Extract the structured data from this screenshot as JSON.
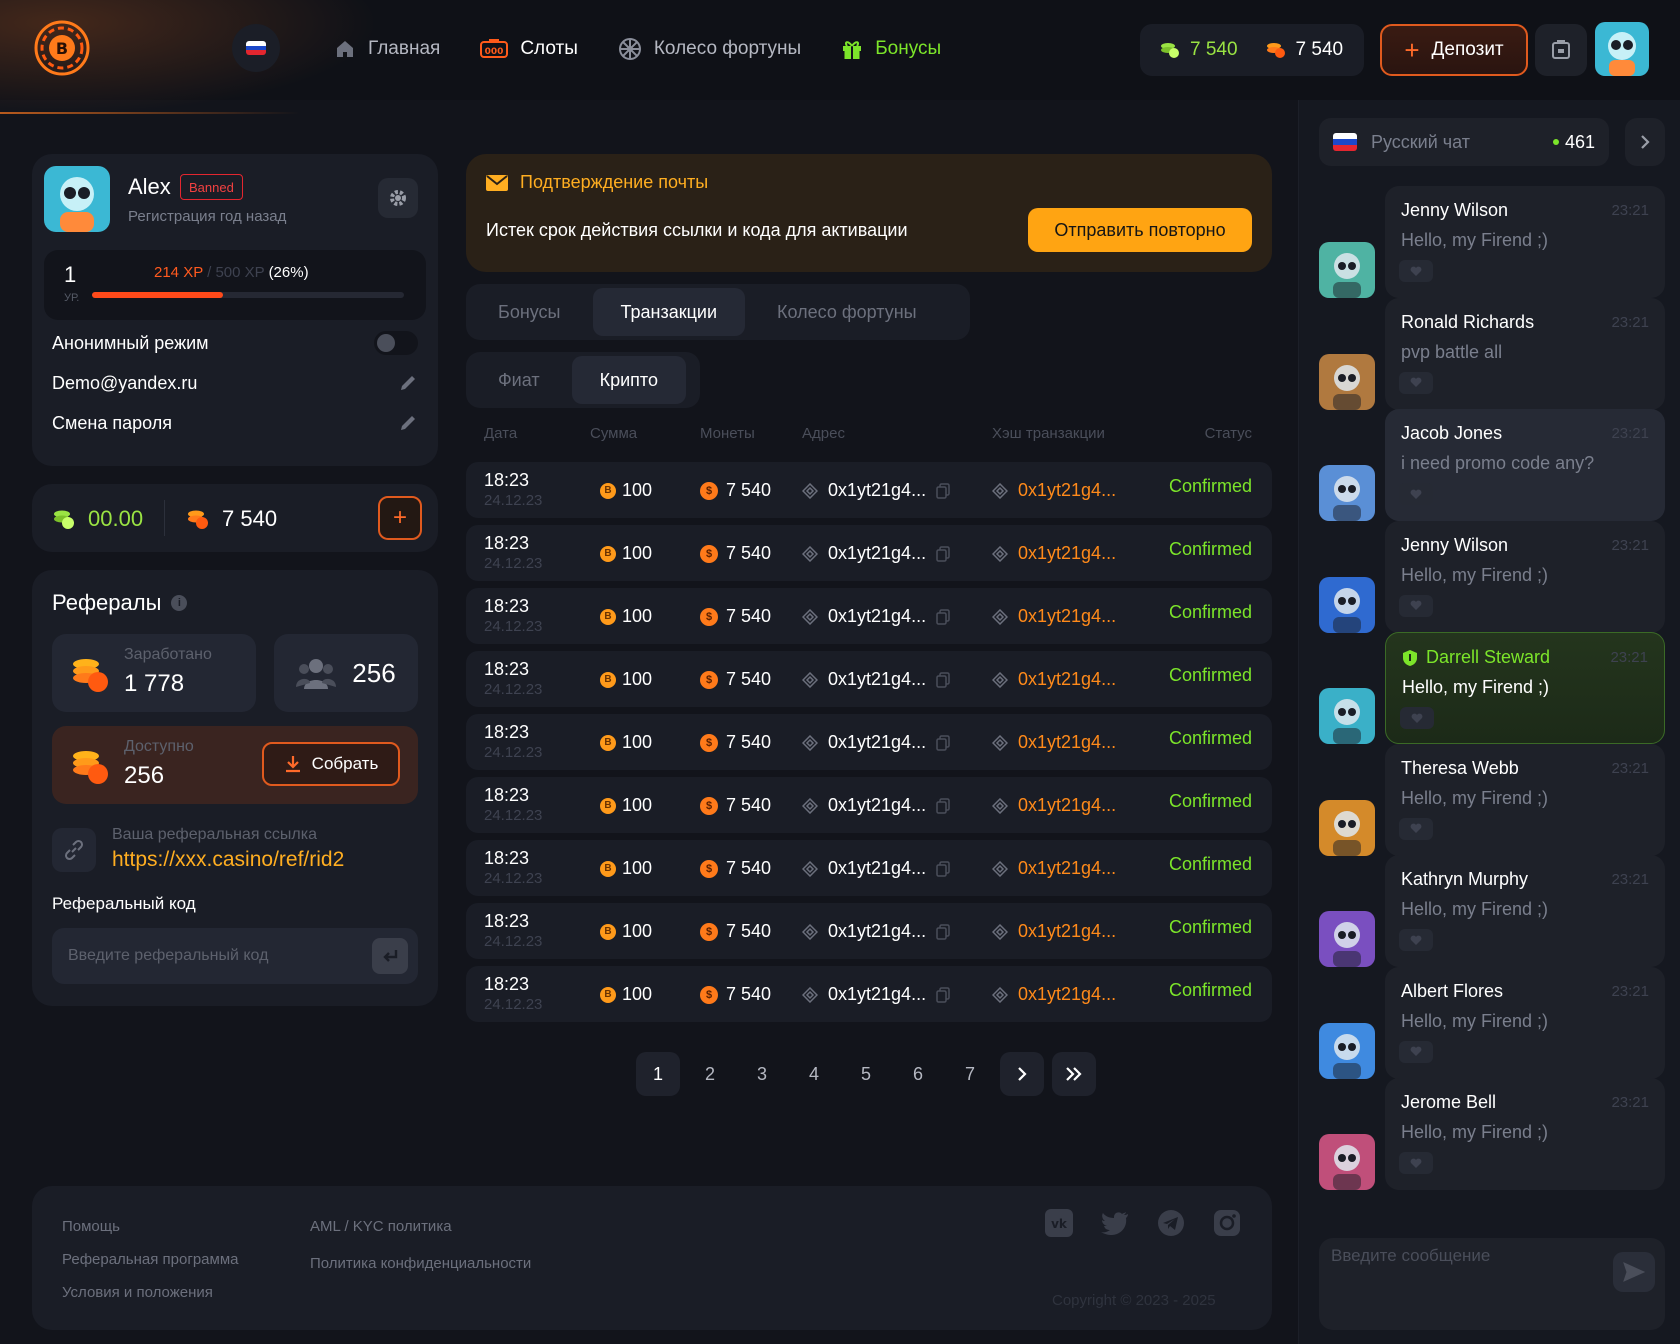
{
  "header": {
    "nav": [
      {
        "label": "Главная",
        "icon": "home-icon"
      },
      {
        "label": "Слоты",
        "icon": "slots-icon"
      },
      {
        "label": "Колесо фортуны",
        "icon": "wheel-icon"
      },
      {
        "label": "Бонусы",
        "icon": "gift-icon"
      }
    ],
    "balance_green": "7 540",
    "balance_orange": "7 540",
    "deposit_label": "Депозит"
  },
  "profile": {
    "name": "Alex",
    "badge": "Banned",
    "registered": "Регистрация год назад",
    "level": "1",
    "level_label": "УР.",
    "xp_current": "214 XP",
    "xp_sep": " / ",
    "xp_max": "500 XP",
    "xp_pct": "(26%)",
    "xp_fraction": 0.42,
    "anon_label": "Анонимный режим",
    "email": "Demo@yandex.ru",
    "password_label": "Смена пароля"
  },
  "wallet": {
    "green": "00.00",
    "orange": "7 540"
  },
  "referrals": {
    "title": "Рефералы",
    "earned_label": "Заработано",
    "earned_value": "1 778",
    "users_count": "256",
    "available_label": "Доступно",
    "available_value": "256",
    "collect_label": "Собрать",
    "link_label": "Ваша реферальная ссылка",
    "link": "https://xxx.casino/ref/rid2",
    "code_label": "Реферальный код",
    "code_placeholder": "Введите реферальный код"
  },
  "alert": {
    "title": "Подтверждение почты",
    "text": "Истек срок действия ссылки и кода для активации",
    "button": "Отправить повторно"
  },
  "tabs": [
    "Бонусы",
    "Транзакции",
    "Колесо фортуны"
  ],
  "subtabs": [
    "Фиат",
    "Крипто"
  ],
  "table": {
    "headers": [
      "Дата",
      "Сумма",
      "Монеты",
      "Адрес",
      "Хэш транзакции",
      "Статус"
    ],
    "rows": [
      {
        "time": "18:23",
        "date": "24.12.23",
        "amount": "100",
        "coins": "7 540",
        "address": "0x1yt21g4...",
        "hash": "0x1yt21g4...",
        "status": "Confirmed"
      },
      {
        "time": "18:23",
        "date": "24.12.23",
        "amount": "100",
        "coins": "7 540",
        "address": "0x1yt21g4...",
        "hash": "0x1yt21g4...",
        "status": "Confirmed"
      },
      {
        "time": "18:23",
        "date": "24.12.23",
        "amount": "100",
        "coins": "7 540",
        "address": "0x1yt21g4...",
        "hash": "0x1yt21g4...",
        "status": "Confirmed"
      },
      {
        "time": "18:23",
        "date": "24.12.23",
        "amount": "100",
        "coins": "7 540",
        "address": "0x1yt21g4...",
        "hash": "0x1yt21g4...",
        "status": "Confirmed"
      },
      {
        "time": "18:23",
        "date": "24.12.23",
        "amount": "100",
        "coins": "7 540",
        "address": "0x1yt21g4...",
        "hash": "0x1yt21g4...",
        "status": "Confirmed"
      },
      {
        "time": "18:23",
        "date": "24.12.23",
        "amount": "100",
        "coins": "7 540",
        "address": "0x1yt21g4...",
        "hash": "0x1yt21g4...",
        "status": "Confirmed"
      },
      {
        "time": "18:23",
        "date": "24.12.23",
        "amount": "100",
        "coins": "7 540",
        "address": "0x1yt21g4...",
        "hash": "0x1yt21g4...",
        "status": "Confirmed"
      },
      {
        "time": "18:23",
        "date": "24.12.23",
        "amount": "100",
        "coins": "7 540",
        "address": "0x1yt21g4...",
        "hash": "0x1yt21g4...",
        "status": "Confirmed"
      },
      {
        "time": "18:23",
        "date": "24.12.23",
        "amount": "100",
        "coins": "7 540",
        "address": "0x1yt21g4...",
        "hash": "0x1yt21g4...",
        "status": "Confirmed"
      }
    ]
  },
  "pagination": [
    "1",
    "2",
    "3",
    "4",
    "5",
    "6",
    "7"
  ],
  "footer": {
    "col1": [
      "Помощь",
      "Реферальная программа",
      "Условия и положения"
    ],
    "col2": [
      "AML / KYC политика",
      "Политика конфиденциальности"
    ],
    "copyright": "Copyright © 2023 - 2025"
  },
  "chat": {
    "title": "Русский чат",
    "online": "461",
    "placeholder": "Введите сообщение",
    "messages": [
      {
        "name": "Jenny Wilson",
        "time": "23:21",
        "text": "Hello, my Firend ;)",
        "avatar_color": "#4fb3a3"
      },
      {
        "name": "Ronald Richards",
        "time": "23:21",
        "text": "pvp battle all",
        "avatar_color": "#b0793f"
      },
      {
        "name": "Jacob Jones",
        "time": "23:21",
        "text": "i need promo code any?",
        "avatar_color": "#5a8fd6"
      },
      {
        "name": "Jenny Wilson",
        "time": "23:21",
        "text": "Hello, my Firend ;)",
        "avatar_color": "#2f6ad0"
      },
      {
        "name": "Darrell Steward",
        "time": "23:21",
        "text": "Hello, my Firend ;)",
        "avatar_color": "#3ab0c8"
      },
      {
        "name": "Theresa Webb",
        "time": "23:21",
        "text": "Hello, my Firend ;)",
        "avatar_color": "#d48a2a"
      },
      {
        "name": "Kathryn Murphy",
        "time": "23:21",
        "text": "Hello, my Firend ;)",
        "avatar_color": "#7a4fc0"
      },
      {
        "name": "Albert Flores",
        "time": "23:21",
        "text": "Hello, my Firend ;)",
        "avatar_color": "#3f8ae0"
      },
      {
        "name": "Jerome Bell",
        "time": "23:21",
        "text": "Hello, my Firend ;)",
        "avatar_color": "#c04f7a"
      }
    ]
  },
  "colors": {
    "accent_orange": "#ff6a2a",
    "accent_green": "#7ce52a",
    "link_orange": "#ffae21"
  }
}
